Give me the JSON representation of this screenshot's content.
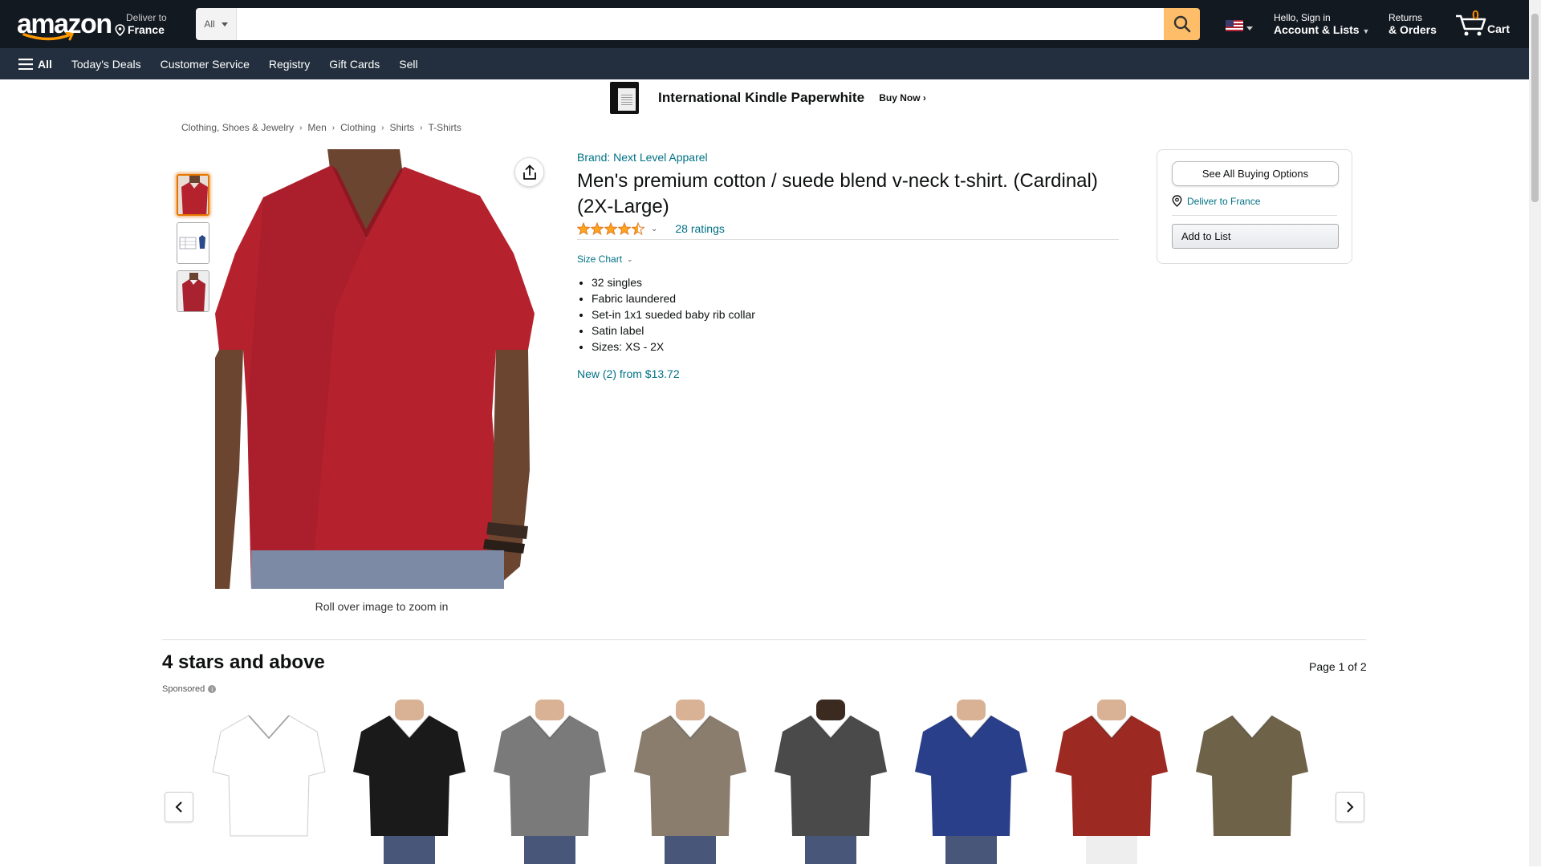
{
  "header": {
    "logo_text": "amazon",
    "deliver_line1": "Deliver to",
    "deliver_line2": "France",
    "search_category": "All",
    "search_placeholder": "",
    "account_line1": "Hello, Sign in",
    "account_line2": "Account & Lists",
    "returns_line1": "Returns",
    "returns_line2": "& Orders",
    "cart_count": "0",
    "cart_label": "Cart"
  },
  "subnav": {
    "all_label": "All",
    "items": [
      "Today's Deals",
      "Customer Service",
      "Registry",
      "Gift Cards",
      "Sell"
    ]
  },
  "banner": {
    "title": "International Kindle Paperwhite",
    "cta": "Buy Now ›"
  },
  "breadcrumb": [
    "Clothing, Shoes & Jewelry",
    "Men",
    "Clothing",
    "Shirts",
    "T-Shirts"
  ],
  "product": {
    "brand": "Brand: Next Level Apparel",
    "title": "Men's premium cotton / suede blend v-neck t-shirt. (Cardinal) (2X-Large)",
    "rating_value": 4.5,
    "rating_count": "28 ratings",
    "size_chart": "Size Chart",
    "bullets": [
      "32 singles",
      "Fabric laundered",
      "Set-in 1x1 sueded baby rib collar",
      "Satin label",
      "Sizes: XS - 2X"
    ],
    "new_from": "New (2) from $13.72",
    "zoom_hint": "Roll over image to zoom in",
    "shirt_color": "#b5222e"
  },
  "buybox": {
    "see_all": "See All Buying Options",
    "deliver": "Deliver to France",
    "add_to_list": "Add to List"
  },
  "carousel": {
    "title": "4 stars and above",
    "page": "Page 1 of 2",
    "sponsored": "Sponsored",
    "items": [
      {
        "color": "#ffffff"
      },
      {
        "color": "#1a1a1a"
      },
      {
        "color": "#7a7a7a"
      },
      {
        "color": "#8a7d6d"
      },
      {
        "color": "#4a4a4a"
      },
      {
        "color": "#2a3f8a"
      },
      {
        "color": "#9c2a22"
      },
      {
        "color": "#6e6248"
      }
    ]
  },
  "colors": {
    "nav_dark": "#131921",
    "nav_sub": "#232f3e",
    "search_button": "#febd69",
    "link": "#007185",
    "star": "#ffa41c"
  }
}
